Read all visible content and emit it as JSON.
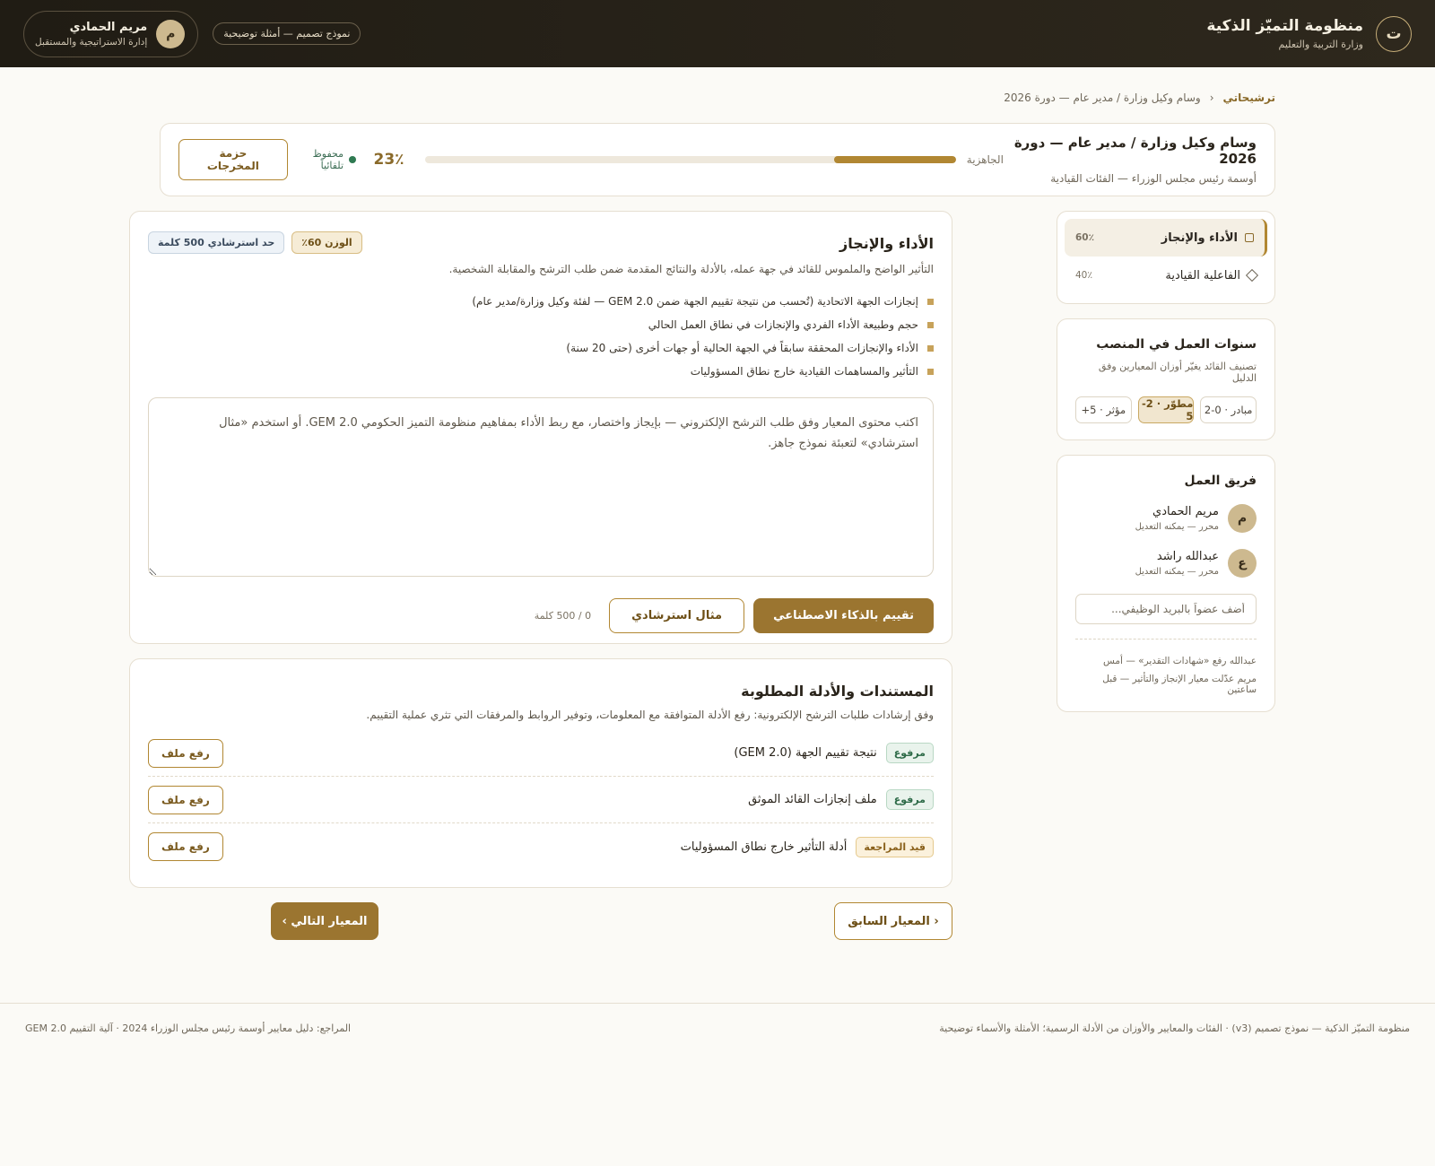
{
  "header": {
    "logo_letter": "ت",
    "app_title": "منظومة التميّز الذكية",
    "app_subtitle": "وزارة التربية والتعليم",
    "demo_chip": "نموذج تصميم — أمثلة توضيحية",
    "user": {
      "initial": "م",
      "name": "مريم الحمادي",
      "role": "إدارة الاستراتيجية والمستقبل"
    }
  },
  "breadcrumb": {
    "root": "ترشيحاتي",
    "separator": "‹",
    "current": "وسام وكيل وزارة / مدير عام — دورة 2026"
  },
  "summary": {
    "title": "وسام وكيل وزارة / مدير عام — دورة 2026",
    "subtitle": "أوسمة رئيس مجلس الوزراء — الفئات القيادية",
    "readiness_label": "الجاهزية",
    "readiness_percent": 23,
    "readiness_text": "23٪",
    "saved_text": "محفوظ تلقائياً",
    "bundle_button": "حزمة المخرجات"
  },
  "criteria": [
    {
      "name": "الأداء والإنجاز",
      "weight": "60٪",
      "active": true,
      "icon": "square-icon"
    },
    {
      "name": "الفاعلية القيادية",
      "weight": "40٪",
      "active": false,
      "icon": "diamond-icon"
    }
  ],
  "years": {
    "title": "سنوات العمل في المنصب",
    "subtitle": "تصنيف القائد يغيّر أوزان المعيارين وفق الدليل",
    "options": [
      "مبادر · 0-2",
      "مطوّر · 2-5",
      "مؤثر · 5+"
    ],
    "selected_index": 1
  },
  "team": {
    "title": "فريق العمل",
    "members": [
      {
        "initial": "م",
        "name": "مريم الحمادي",
        "role": "محرر — يمكنه التعديل"
      },
      {
        "initial": "ع",
        "name": "عبدالله راشد",
        "role": "محرر — يمكنه التعديل"
      }
    ],
    "invite_placeholder": "أضف عضواً بالبريد الوظيفي...",
    "activity": [
      "عبدالله رفع «شهادات التقدير» — أمس",
      "مريم عدّلت معيار الإنجاز والتأثير — قبل ساعتين"
    ]
  },
  "criterion": {
    "title": "الأداء والإنجاز",
    "weight_badge": "الوزن 60٪",
    "words_badge": "حد استرشادي 500 كلمة",
    "description": "التأثير الواضح والملموس للقائد في جهة عمله، بالأدلة والنتائج المقدمة ضمن طلب الترشح والمقابلة الشخصية.",
    "bullets": [
      "إنجازات الجهة الاتحادية (تُحسب من نتيجة تقييم الجهة ضمن GEM 2.0 — لفئة وكيل وزارة/مدير عام)",
      "حجم وطبيعة الأداء الفردي والإنجازات في نطاق العمل الحالي",
      "الأداء والإنجازات المحققة سابقاً في الجهة الحالية أو جهات أخرى (حتى 20 سنة)",
      "التأثير والمساهمات القيادية خارج نطاق المسؤوليات"
    ],
    "editor_placeholder": "اكتب محتوى المعيار وفق طلب الترشح الإلكتروني — بإيجاز واختصار، مع ربط الأداء بمفاهيم منظومة التميز الحكومي GEM 2.0. أو استخدم «مثال استرشادي» لتعبئة نموذج جاهز.",
    "ai_button": "تقييم بالذكاء الاصطناعي",
    "example_button": "مثال استرشادي",
    "word_count": "0 / 500 كلمة"
  },
  "documents": {
    "title": "المستندات والأدلة المطلوبة",
    "description": "وفق إرشادات طلبات الترشح الإلكترونية: رفع الأدلة المتوافقة مع المعلومات، وتوفير الروابط والمرفقات التي تثري عملية التقييم.",
    "upload_label": "رفع ملف",
    "items": [
      {
        "status": "مرفوع",
        "status_type": "uploaded",
        "name": "نتيجة تقييم الجهة (GEM 2.0)"
      },
      {
        "status": "مرفوع",
        "status_type": "uploaded",
        "name": "ملف إنجازات القائد الموثق"
      },
      {
        "status": "قيد المراجعة",
        "status_type": "review",
        "name": "أدلة التأثير خارج نطاق المسؤوليات"
      }
    ]
  },
  "nav": {
    "prev": "‹ المعيار السابق",
    "next": "المعيار التالي ›"
  },
  "footer": {
    "right": "منظومة التميّز الذكية — نموذج تصميم (v3) · الفئات والمعايير والأوزان من الأدلة الرسمية؛ الأمثلة والأسماء توضيحية",
    "left": "المراجع: دليل معايير أوسمة رئيس مجلس الوزراء 2024 · آلية التقييم GEM 2.0"
  },
  "colors": {
    "accent": "#b18732",
    "header_bg": "#201c14",
    "success": "#2f7a52"
  }
}
